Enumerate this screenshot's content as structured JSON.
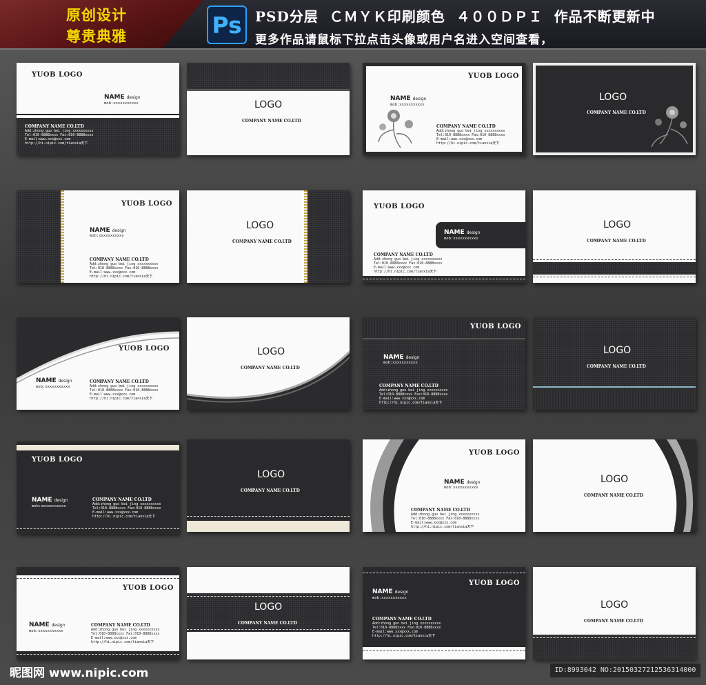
{
  "header": {
    "badge_line1": "原创设计",
    "badge_line2": "尊贵典雅",
    "ps_icon": "Ps",
    "line1": "PSD分层  ＣＭＹＫ印刷颜色  ４００ＤＰＩ  作品不断更新中",
    "line2": "更多作品请鼠标下拉点击头像或用户名进入空间查看，"
  },
  "card_text": {
    "your_logo": "YUOB LOGO",
    "logo": "LOGO",
    "company": "COMPANY NAME CO.LTD",
    "name": "NAME",
    "design": "design",
    "mob": "mob:xxxxxxxxxxx",
    "add": "Add:zhong guo bei jing xxxxxxxxxx",
    "tel": "Tel:010-8888xxxx Fax:010-8888xxxx",
    "email": "E-mail:www.xxx@xxx.com",
    "http": "http://hi.nipic.com/tianxia天下"
  },
  "footer": {
    "watermark": "昵图网 www.nipic.com",
    "id": "ID:8993042 NO:20150327212536314000"
  },
  "colors": {
    "header_bg": "#1a1a22",
    "badge_red": "#6a1c1c",
    "badge_text": "#f3d800",
    "ps_blue": "#2aa2ff",
    "card_dark": "#2a2a2c",
    "card_light": "#fafafa",
    "accent_cream": "#efe8d8",
    "accent_blue_line": "#8fb6c8"
  }
}
